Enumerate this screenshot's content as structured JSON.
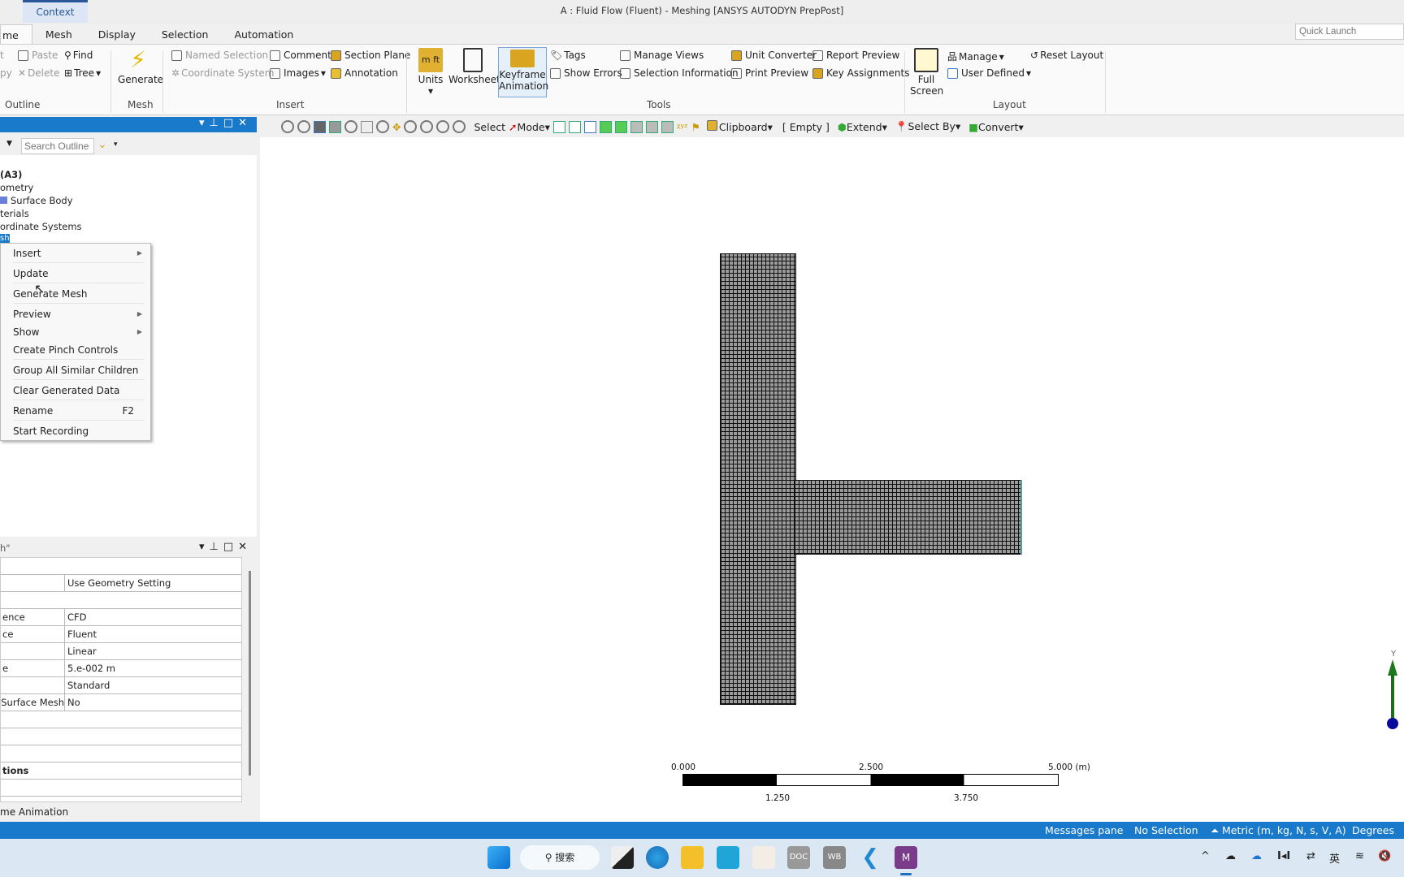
{
  "window": {
    "title": "A : Fluid Flow (Fluent) - Meshing [ANSYS AUTODYN PrepPost]",
    "context_tab": "Context",
    "quick_launch_placeholder": "Quick Launch"
  },
  "ribbon_tabs": [
    "me",
    "Mesh",
    "Display",
    "Selection",
    "Automation"
  ],
  "ribbon": {
    "outline": {
      "label": "Outline",
      "items": [
        "t",
        "Paste",
        "Find",
        "py",
        "Delete",
        "Tree"
      ]
    },
    "mesh": {
      "label": "Mesh",
      "generate": "Generate"
    },
    "insert": {
      "label": "Insert",
      "items": [
        "Named Selection",
        "Comment",
        "Section Plane",
        "Coordinate System",
        "Images",
        "Annotation"
      ]
    },
    "tools": {
      "label": "Tools",
      "units": "Units",
      "worksheet": "Worksheet",
      "keyframe": "Keyframe Animation",
      "items": [
        "Tags",
        "Manage Views",
        "Unit Converter",
        "Report Preview",
        "Show Errors",
        "Selection Information",
        "Print Preview",
        "Key Assignments"
      ]
    },
    "layout": {
      "label": "Layout",
      "full_screen": "Full Screen",
      "items": [
        "Manage",
        "Reset Layout",
        "User Defined"
      ]
    }
  },
  "toolbar": {
    "select": "Select",
    "mode": "Mode",
    "clipboard": "Clipboard",
    "empty": "[ Empty ]",
    "extend": "Extend",
    "select_by": "Select By",
    "convert": "Convert"
  },
  "outline": {
    "search_placeholder": "Search Outline",
    "tree": [
      "(A3)",
      "ometry",
      "Surface Body",
      "terials",
      "ordinate Systems",
      "sh"
    ]
  },
  "context_menu": [
    {
      "label": "Insert",
      "submenu": true
    },
    {
      "label": "Update"
    },
    {
      "label": "Generate Mesh"
    },
    {
      "label": "Preview",
      "submenu": true
    },
    {
      "label": "Show",
      "submenu": true
    },
    {
      "label": "Create Pinch Controls"
    },
    {
      "label": "Group All Similar Children"
    },
    {
      "label": "Clear Generated Data"
    },
    {
      "label": "Rename",
      "shortcut": "F2"
    },
    {
      "label": "Start Recording"
    }
  ],
  "details": {
    "title": "h\"",
    "rows": [
      {
        "k": "",
        "v": "Use Geometry Setting"
      },
      {
        "k": "",
        "v": ""
      },
      {
        "k": "ence",
        "v": "CFD"
      },
      {
        "k": "ce",
        "v": "Fluent"
      },
      {
        "k": "",
        "v": "Linear"
      },
      {
        "k": "e",
        "v": "5.e-002 m"
      },
      {
        "k": "",
        "v": "Standard"
      },
      {
        "k": " Surface Mesh",
        "v": "No"
      },
      {
        "k": "",
        "v": ""
      },
      {
        "k": "",
        "v": ""
      },
      {
        "k": "",
        "v": ""
      },
      {
        "k": "tions",
        "v": "",
        "bold": true
      },
      {
        "k": "",
        "v": ""
      }
    ],
    "bottom_tab": "me Animation"
  },
  "scale": {
    "labels_top": [
      "0.000",
      "2.500",
      "5.000 (m)"
    ],
    "labels_bottom": [
      "1.250",
      "3.750"
    ]
  },
  "triad": {
    "axis": "Y"
  },
  "status": {
    "messages": "Messages pane",
    "selection": "No Selection",
    "units": "Metric (m, kg, N, s, V, A)",
    "angle": "Degrees"
  },
  "taskbar": {
    "search": "搜索",
    "ime": "英"
  },
  "colors": {
    "accent": "#1979ca",
    "mesh_fill": "#9a9a9a"
  }
}
